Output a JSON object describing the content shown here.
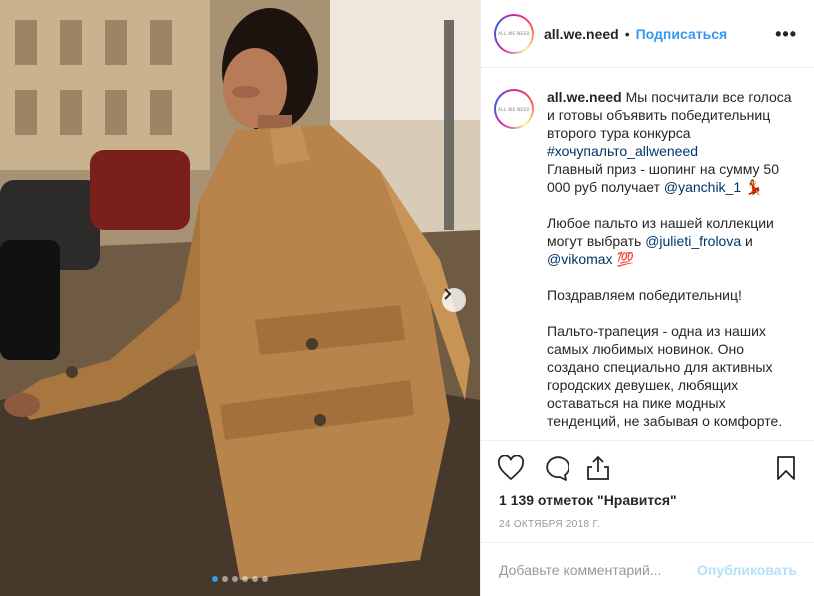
{
  "post": {
    "username": "all.we.need",
    "separator": "•",
    "follow_label": "Подписаться",
    "more_icon": "more-horizontal-icon",
    "avatar_logo": "ALL.WE.NEED",
    "caption_lines": [
      "Мы посчитали все голоса",
      "и готовы объявить победительниц",
      "второго тура конкурса",
      "#хочупальто_allweneed",
      "Главный приз - шопинг на сумму 50",
      "000 руб получает @yanchik_1 💃",
      "",
      "Любое пальто из нашей коллекции",
      "могут выбрать @julieti_frolova и",
      "@vikomax 💯",
      "",
      "Поздравляем победительниц!",
      "",
      "Пальто-трапеция - одна из наших",
      "самых любимых новинок. Оно",
      "создано специально для активных",
      "городских девушек, любящих",
      "оставаться на пике модных",
      "тенденций, не забывая о комфорте."
    ],
    "caption": {
      "intro": "Мы посчитали все голоса\nи готовы объявить победительниц\nвторого тура конкурса\n",
      "hashtag": "#хочупальто_allweneed",
      "prize_text": "\nГлавный приз - шопинг на сумму 50\n000 руб получает ",
      "winner_1": "@yanchik_1",
      "winner_1_emoji": " 💃",
      "coats_text": "\n\nЛюбое пальто из нашей коллекции\nмогут выбрать ",
      "winner_2": "@julieti_frolova",
      "and_text": " и\n",
      "winner_3": "@vikomax",
      "winner_3_emoji": " 💯",
      "congrats": "\n\nПоздравляем победительниц!\n\nПальто-трапеция - одна из наших\nсамых любимых новинок. Оно\nсоздано специально для активных\nгородских девушек, любящих\nоставаться на пике модных\nтенденций, не забывая о комфорте."
    },
    "likes_text": "1 139 отметок \"Нравится\"",
    "date_text": "24 ОКТЯБРЯ 2018 Г.",
    "comment_placeholder": "Добавьте комментарий...",
    "publish_label": "Опубликовать",
    "carousel": {
      "slides": 6,
      "active": 1
    }
  },
  "colors": {
    "link": "#3897f0",
    "hashtag": "#003569",
    "publish_disabled": "#b2dffc",
    "text": "#262626",
    "muted": "#999999"
  },
  "icons": {
    "like": "heart-icon",
    "comment": "comment-icon",
    "share": "share-icon",
    "save": "bookmark-icon",
    "next": "chevron-right-icon"
  }
}
